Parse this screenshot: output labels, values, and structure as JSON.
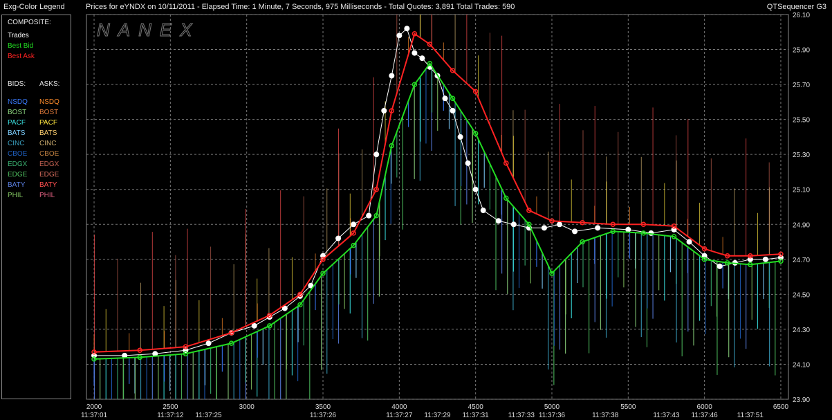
{
  "window": {
    "legend_title": "Exg-Color Legend",
    "chart_title": "Prices for  eYNDX  on  10/11/2011  -  Elapsed Time: 1 Minute, 7 Seconds, 975 Milliseconds  -  Total Quotes: 3,891  Total Trades: 590",
    "app_name": "QTSequencer G3",
    "watermark": "NANEX"
  },
  "legend": {
    "composite_header": "COMPOSITE:",
    "composite": [
      {
        "label": "Trades",
        "color": "#ffffff"
      },
      {
        "label": "Best Bid",
        "color": "#22dd22"
      },
      {
        "label": "Best Ask",
        "color": "#ff2222"
      }
    ],
    "bids_header": "BIDS:",
    "asks_header": "ASKS:",
    "exchanges": [
      {
        "bid": "NSDQ",
        "ask": "NSDQ",
        "bid_color": "#3a7bff",
        "ask_color": "#ff8c2a"
      },
      {
        "bid": "BOST",
        "ask": "BOST",
        "bid_color": "#8cd47e",
        "ask_color": "#e07a3a"
      },
      {
        "bid": "PACF",
        "ask": "PACF",
        "bid_color": "#3ae0e0",
        "ask_color": "#ffe640"
      },
      {
        "bid": "BATS",
        "ask": "BATS",
        "bid_color": "#7ecfff",
        "ask_color": "#ffd070"
      },
      {
        "bid": "CINC",
        "ask": "CINC",
        "bid_color": "#3aa0c0",
        "ask_color": "#d0b070"
      },
      {
        "bid": "CBOE",
        "ask": "CBOE",
        "bid_color": "#1f5fbf",
        "ask_color": "#c08040"
      },
      {
        "bid": "EDGX",
        "ask": "EDGX",
        "bid_color": "#3ab070",
        "ask_color": "#c06050"
      },
      {
        "bid": "EDGE",
        "ask": "EDGE",
        "bid_color": "#4fc060",
        "ask_color": "#e07060"
      },
      {
        "bid": "BATY",
        "ask": "BATY",
        "bid_color": "#5a7fe0",
        "ask_color": "#ff5050"
      },
      {
        "bid": "PHIL",
        "ask": "PHIL",
        "bid_color": "#7fbf5f",
        "ask_color": "#e06080"
      }
    ]
  },
  "chart_data": {
    "type": "line",
    "ylim": [
      23.9,
      26.1
    ],
    "yticks": [
      "26.10",
      "25.90",
      "25.70",
      "25.50",
      "25.30",
      "25.10",
      "24.90",
      "24.70",
      "24.50",
      "24.30",
      "24.10",
      "23.90"
    ],
    "xlim": [
      1950,
      6550
    ],
    "xticks": [
      {
        "seq": 2000,
        "label": "2000",
        "time": "11:37:01"
      },
      {
        "seq": 2500,
        "label": "2500",
        "time": "11:37:12"
      },
      {
        "seq": 2750,
        "label": "",
        "time": "11:37:25"
      },
      {
        "seq": 3000,
        "label": "3000",
        "time": ""
      },
      {
        "seq": 3500,
        "label": "3500",
        "time": "11:37:26"
      },
      {
        "seq": 4000,
        "label": "4000",
        "time": "11:37:27"
      },
      {
        "seq": 4250,
        "label": "",
        "time": "11:37:29"
      },
      {
        "seq": 4500,
        "label": "4500",
        "time": "11:37:31"
      },
      {
        "seq": 4800,
        "label": "",
        "time": "11:37:33"
      },
      {
        "seq": 5000,
        "label": "5000",
        "time": "11:37:36"
      },
      {
        "seq": 5350,
        "label": "",
        "time": "11:37:38"
      },
      {
        "seq": 5500,
        "label": "5500",
        "time": ""
      },
      {
        "seq": 5750,
        "label": "",
        "time": "11:37:43"
      },
      {
        "seq": 6000,
        "label": "6000",
        "time": "11:37:46"
      },
      {
        "seq": 6300,
        "label": "",
        "time": "11:37:51"
      },
      {
        "seq": 6500,
        "label": "6500",
        "time": ""
      }
    ],
    "series": [
      {
        "name": "Trades",
        "color": "#ffffff",
        "x": [
          2000,
          2200,
          2400,
          2600,
          2750,
          2900,
          3050,
          3150,
          3250,
          3350,
          3420,
          3500,
          3600,
          3700,
          3800,
          3850,
          3900,
          3950,
          4000,
          4050,
          4100,
          4150,
          4200,
          4250,
          4300,
          4350,
          4400,
          4450,
          4500,
          4550,
          4650,
          4750,
          4850,
          4950,
          5050,
          5150,
          5300,
          5500,
          5650,
          5800,
          5900,
          6000,
          6100,
          6200,
          6300,
          6400,
          6500
        ],
        "y": [
          24.15,
          24.15,
          24.16,
          24.18,
          24.22,
          24.28,
          24.32,
          24.37,
          24.42,
          24.49,
          24.55,
          24.72,
          24.82,
          24.9,
          24.95,
          25.3,
          25.55,
          25.75,
          25.98,
          26.02,
          25.88,
          25.85,
          25.8,
          25.75,
          25.62,
          25.55,
          25.4,
          25.25,
          25.1,
          24.98,
          24.92,
          24.9,
          24.88,
          24.88,
          24.9,
          24.86,
          24.88,
          24.87,
          24.85,
          24.87,
          24.8,
          24.72,
          24.66,
          24.68,
          24.7,
          24.7,
          24.71
        ]
      },
      {
        "name": "Best Bid",
        "color": "#22dd22",
        "x": [
          2000,
          2300,
          2600,
          2900,
          3150,
          3350,
          3500,
          3700,
          3850,
          3950,
          4100,
          4200,
          4350,
          4500,
          4700,
          4850,
          5000,
          5200,
          5400,
          5600,
          5800,
          6000,
          6150,
          6300,
          6500
        ],
        "y": [
          24.13,
          24.14,
          24.16,
          24.22,
          24.32,
          24.44,
          24.62,
          24.78,
          24.95,
          25.35,
          25.7,
          25.82,
          25.62,
          25.42,
          25.05,
          24.9,
          24.62,
          24.8,
          24.86,
          24.85,
          24.83,
          24.7,
          24.68,
          24.67,
          24.69
        ]
      },
      {
        "name": "Best Ask",
        "color": "#ff2222",
        "x": [
          2000,
          2300,
          2600,
          2900,
          3150,
          3350,
          3500,
          3700,
          3850,
          3950,
          4100,
          4200,
          4350,
          4500,
          4700,
          4850,
          5000,
          5200,
          5400,
          5600,
          5800,
          6000,
          6150,
          6300,
          6500
        ],
        "y": [
          24.17,
          24.18,
          24.2,
          24.28,
          24.38,
          24.5,
          24.7,
          24.85,
          25.1,
          25.55,
          25.99,
          25.93,
          25.78,
          25.66,
          25.25,
          24.98,
          24.92,
          24.91,
          24.9,
          24.9,
          24.89,
          24.76,
          24.72,
          24.72,
          24.73
        ]
      }
    ]
  }
}
